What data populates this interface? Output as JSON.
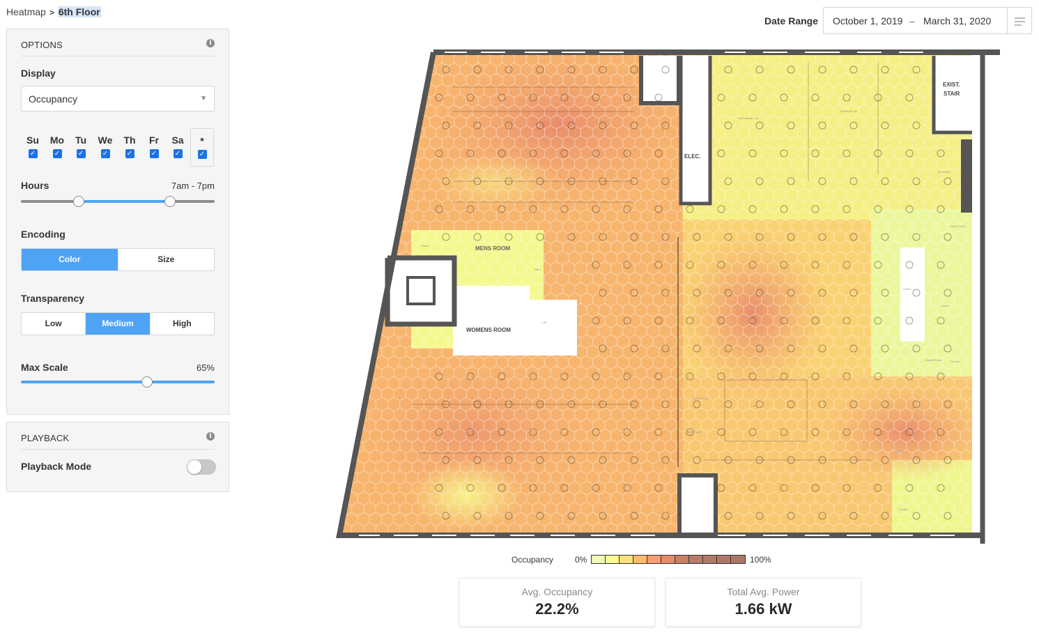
{
  "breadcrumb": {
    "root": "Heatmap",
    "separator": ">",
    "current": "6th Floor"
  },
  "options": {
    "title": "OPTIONS",
    "info_icon": "info-icon",
    "display": {
      "label": "Display",
      "value": "Occupancy"
    },
    "days": [
      {
        "label": "Su",
        "checked": true
      },
      {
        "label": "Mo",
        "checked": true
      },
      {
        "label": "Tu",
        "checked": true
      },
      {
        "label": "We",
        "checked": true
      },
      {
        "label": "Th",
        "checked": true
      },
      {
        "label": "Fr",
        "checked": true
      },
      {
        "label": "Sa",
        "checked": true
      },
      {
        "label": "*",
        "checked": true
      }
    ],
    "hours": {
      "label": "Hours",
      "value": "7am - 7pm",
      "range_start_fraction": 0.3,
      "range_end_fraction": 0.77
    },
    "encoding": {
      "label": "Encoding",
      "options": [
        "Color",
        "Size"
      ],
      "selected": "Color"
    },
    "transparency": {
      "label": "Transparency",
      "options": [
        "Low",
        "Medium",
        "High"
      ],
      "selected": "Medium"
    },
    "max_scale": {
      "label": "Max Scale",
      "value": "65%",
      "fraction": 0.65
    }
  },
  "playback": {
    "title": "PLAYBACK",
    "info_icon": "info-icon",
    "mode_label": "Playback Mode",
    "enabled": false
  },
  "date_range": {
    "label": "Date Range",
    "start": "October 1, 2019",
    "separator": "–",
    "end": "March 31, 2020",
    "menu_icon": "menu-lines-icon"
  },
  "floorplan": {
    "labels": {
      "elec": "ELEC.",
      "exist_stair_1": "EXIST.",
      "exist_stair_2": "STAIR",
      "mens_room": "MENS ROOM",
      "womens_room": "WOMENS ROOM",
      "mechanical_lab": "Mechanical Lab",
      "electrical_lab": "Electrical Lab",
      "lab_annex": "Lab Annex",
      "office": "Office",
      "lab": "Lab",
      "closet": "Closet",
      "closet2": "Closet",
      "locker": "Locker",
      "utility_closet": "Utility Closet",
      "health_room": "Health Room",
      "shower": "Shower",
      "server_room": "Server Room",
      "bike_repair": "Bike Repair",
      "cr": "CR",
      "pantry": "Pantry",
      "lounge": "Lounge"
    }
  },
  "legend": {
    "label": "Occupancy",
    "min": "0%",
    "max": "100%",
    "colors": [
      "#eefbb6",
      "#fdfb8e",
      "#fde17e",
      "#fcbc6e",
      "#f59f6e",
      "#e88a6c",
      "#c58068",
      "#b67c68",
      "#b07a67",
      "#ad7966",
      "#ab7865"
    ]
  },
  "stats": [
    {
      "title": "Avg. Occupancy",
      "value": "22.2%"
    },
    {
      "title": "Total Avg. Power",
      "value": "1.66 kW"
    }
  ]
}
